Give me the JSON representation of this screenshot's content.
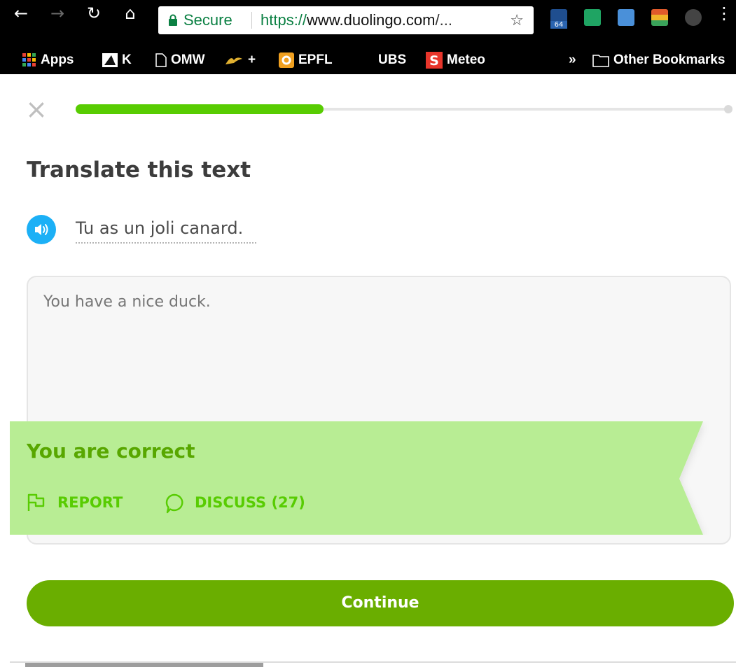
{
  "browser": {
    "security_label": "Secure",
    "url_scheme": "https://",
    "url_host": "www.duolingo.com",
    "url_rest": "/...",
    "extension_badge": "64",
    "bookmarks": [
      {
        "label": "Apps"
      },
      {
        "label": "K"
      },
      {
        "label": "OMW"
      },
      {
        "label": "+"
      },
      {
        "label": "EPFL"
      },
      {
        "label": "UBS"
      },
      {
        "label": "Meteo"
      },
      {
        "label": "»"
      },
      {
        "label": "Other Bookmarks"
      }
    ]
  },
  "lesson": {
    "progress_fraction": 0.38,
    "title": "Translate this text",
    "prompt_sentence": "Tu as un joli canard.",
    "answer_text": "You have a nice duck."
  },
  "feedback": {
    "title": "You are correct",
    "report_label": "REPORT",
    "discuss_label": "DISCUSS (27)"
  },
  "footer": {
    "continue_label": "Continue"
  },
  "colors": {
    "progress": "#58cc02",
    "banner_bg": "#b8ed94",
    "banner_text": "#58a700",
    "continue_bg": "#6aae00",
    "speaker": "#1cb0f6"
  }
}
